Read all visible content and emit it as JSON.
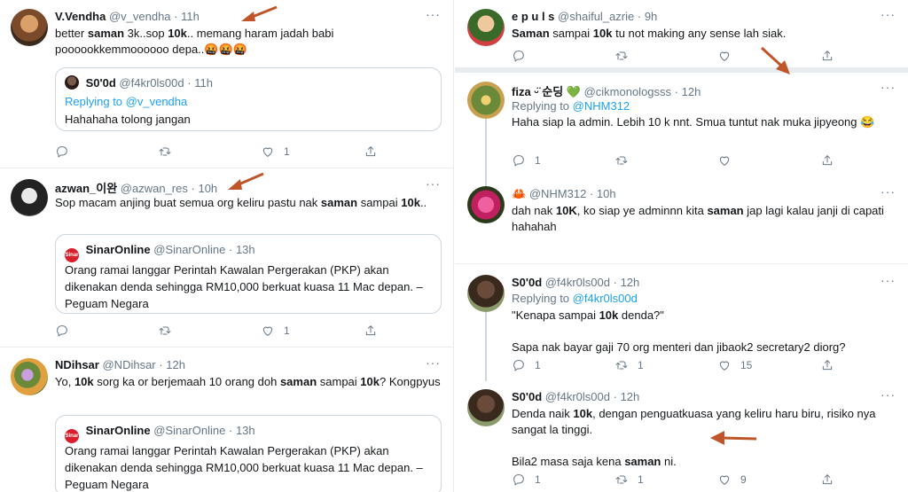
{
  "left": {
    "tweets": [
      {
        "name": "V.Vendha",
        "handle": "@v_vendha",
        "time": "11h",
        "text_html": "better <b>saman</b> 3k..sop <b>10k</b>.. memang haram jadah babi poooookkemmoooooo depa..🤬🤬🤬",
        "quote": {
          "name": "S0'0d",
          "handle": "@f4kr0ls00d",
          "time": "11h",
          "reply_prefix": "Replying to ",
          "reply_link": "@v_vendha",
          "text": "Hahahaha tolong jangan"
        },
        "likes": "1"
      },
      {
        "name": "azwan_이완",
        "handle": "@azwan_res",
        "time": "10h",
        "text_html": "Sop macam anjing buat semua org keliru pastu nak <b>saman</b> sampai <b>10k</b>..",
        "quote": {
          "name": "SinarOnline",
          "handle": "@SinarOnline",
          "time": "13h",
          "text": "Orang ramai langgar Perintah Kawalan Pergerakan (PKP) akan dikenakan denda sehingga RM10,000 berkuat kuasa 11 Mac depan. – Peguam Negara"
        },
        "likes": "1"
      },
      {
        "name": "NDihsar",
        "handle": "@NDihsar",
        "time": "12h",
        "text_html": "Yo, <b>10k</b> sorg ka or berjemaah 10 orang doh <b>saman</b> sampai <b>10k</b>? Kongpyus",
        "quote": {
          "name": "SinarOnline",
          "handle": "@SinarOnline",
          "time": "13h",
          "text": "Orang ramai langgar Perintah Kawalan Pergerakan (PKP) akan dikenakan denda sehingga RM10,000 berkuat kuasa 11 Mac depan. – Peguam Negara"
        }
      }
    ]
  },
  "right": {
    "tweets": [
      {
        "name": "e p u l s",
        "handle": "@shaiful_azrie",
        "time": "9h",
        "text_html": "<b>Saman</b> sampai <b>10k</b> tu not making any sense lah siak."
      },
      {
        "name": "fiza ᵕ̈ 순딩 💚",
        "handle": "@cikmonologsss",
        "time": "12h",
        "reply_prefix": "Replying to ",
        "reply_link": "@NHM312",
        "text_html": "Haha siap la admin. Lebih 10 k nnt. Smua tuntut nak muka jipyeong 😂",
        "replies": "1"
      },
      {
        "name": "🦀",
        "handle": "@NHM312",
        "time": "10h",
        "text_html": "dah nak <b>10K</b>, ko siap ye adminnn kita <b>saman</b> jap lagi kalau janji di capati hahahah"
      },
      {
        "name": "S0'0d",
        "handle": "@f4kr0ls00d",
        "time": "12h",
        "reply_prefix": "Replying to ",
        "reply_link": "@f4kr0ls00d",
        "text_html": "\"Kenapa sampai <b>10k</b> denda?\"<br><br>Sapa nak bayar gaji 70 org menteri dan jibaok2 secretary2 diorg?",
        "replies": "1",
        "retweets": "1",
        "likes": "15"
      },
      {
        "name": "S0'0d",
        "handle": "@f4kr0ls00d",
        "time": "12h",
        "text_html": "Denda naik <b>10k</b>, dengan penguatkuasa yang keliru haru biru, risiko nya sangat la tinggi.<br><br>Bila2 masa saja kena <b>saman</b> ni.",
        "replies": "1",
        "retweets": "1",
        "likes": "9"
      }
    ]
  },
  "common": {
    "dot": "·",
    "more": "···",
    "sinar_logo": "Sinar"
  },
  "colors": {
    "link": "#1da1f2",
    "muted": "#657786",
    "arrow": "#c0552a"
  }
}
